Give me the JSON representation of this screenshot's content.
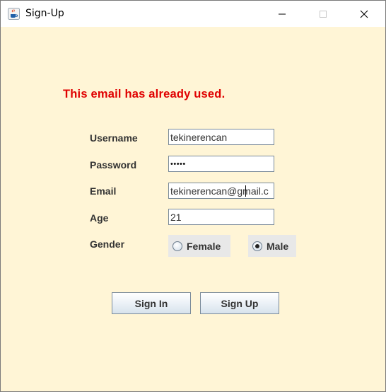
{
  "window": {
    "title": "Sign-Up"
  },
  "error": {
    "message": "This email has already used."
  },
  "form": {
    "username": {
      "label": "Username",
      "value": "tekinerencan"
    },
    "password": {
      "label": "Password",
      "value": "•••••"
    },
    "email": {
      "label": "Email",
      "value": "tekinerencan@gmail.c"
    },
    "age": {
      "label": "Age",
      "value": "21"
    },
    "gender": {
      "label": "Gender",
      "options": [
        "Female",
        "Male"
      ],
      "selected": "Male"
    }
  },
  "buttons": {
    "sign_in": "Sign In",
    "sign_up": "Sign Up"
  },
  "colors": {
    "background": "#fff5d6",
    "error": "#e00000"
  },
  "icons": {
    "app": "java-coffee-cup-icon",
    "minimize": "minimize-icon",
    "maximize": "maximize-icon",
    "close": "close-icon"
  }
}
